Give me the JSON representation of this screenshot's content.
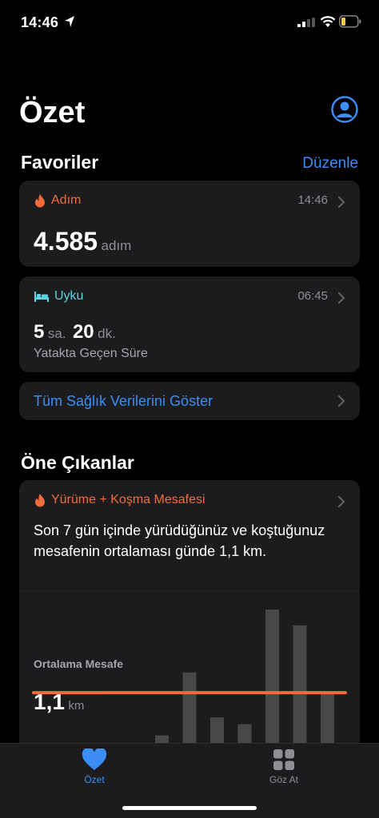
{
  "status_bar": {
    "time": "14:46"
  },
  "header": {
    "title": "Özet"
  },
  "favorites": {
    "title": "Favoriler",
    "edit_label": "Düzenle",
    "steps": {
      "label": "Adım",
      "time": "14:46",
      "value": "4.585",
      "unit": "adım"
    },
    "sleep": {
      "label": "Uyku",
      "time": "06:45",
      "hours": "5",
      "hours_unit": "sa.",
      "minutes": "20",
      "minutes_unit": "dk.",
      "caption": "Yatakta Geçen Süre"
    },
    "show_all_label": "Tüm Sağlık Verilerini Göster"
  },
  "highlights": {
    "title": "Öne Çıkanlar",
    "card": {
      "label": "Yürüme + Koşma Mesafesi",
      "text": "Son 7 gün içinde yürüdüğünüz ve koştuğunuz mesafenin ortalaması günde 1,1 km.",
      "avg_label": "Ortalama Mesafe",
      "avg_value": "1,1",
      "avg_unit": "km"
    }
  },
  "chart_data": {
    "type": "bar",
    "average": 1.1,
    "values": [
      0.15,
      1.55,
      0.55,
      0.4,
      2.95,
      2.6,
      1.1
    ],
    "ylim": [
      0,
      3.2
    ]
  },
  "tab_bar": {
    "items": [
      {
        "label": "Özet",
        "active": true
      },
      {
        "label": "Göz At",
        "active": false
      }
    ]
  },
  "colors": {
    "accent": "#3a8ef6",
    "highlight": "#f26b3a",
    "sleep": "#5ed2e6",
    "card": "#1c1c1e"
  }
}
